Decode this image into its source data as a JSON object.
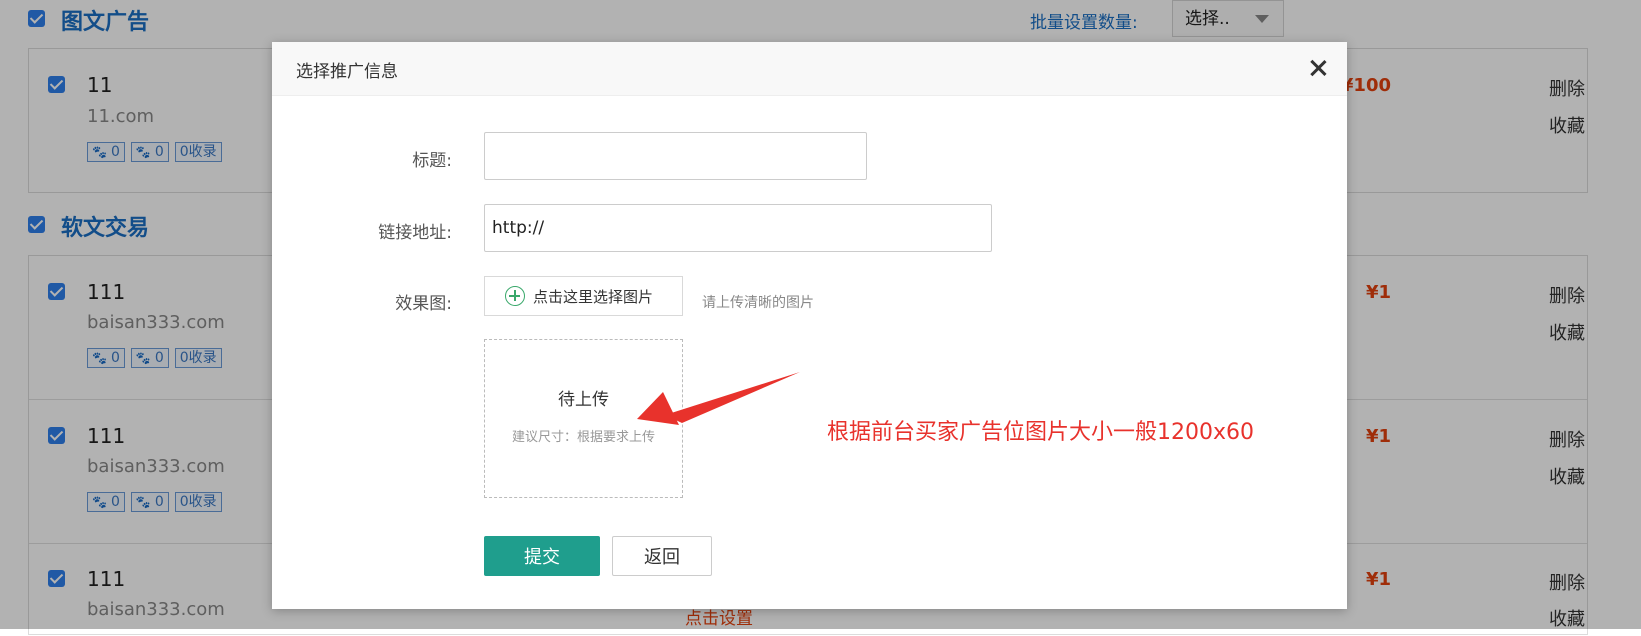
{
  "background": {
    "batch_label": "批量设置数量:",
    "batch_select_value": "选择..",
    "sections": [
      {
        "title": "图文广告",
        "rows": [
          {
            "name": "11",
            "domain": "11.com",
            "badge1": "0",
            "badge2": "0",
            "badge3": "0收录",
            "price": "¥100",
            "delete": "删除",
            "favorite": "收藏"
          }
        ]
      },
      {
        "title": "软文交易",
        "rows": [
          {
            "name": "111",
            "domain": "baisan333.com",
            "badge1": "0",
            "badge2": "0",
            "badge3": "0收录",
            "price": "¥1",
            "delete": "删除",
            "favorite": "收藏"
          },
          {
            "name": "111",
            "domain": "baisan333.com",
            "badge1": "0",
            "badge2": "0",
            "badge3": "0收录",
            "price": "¥1",
            "delete": "删除",
            "favorite": "收藏"
          },
          {
            "name": "111",
            "domain": "baisan333.com",
            "price": "¥1",
            "delete": "删除",
            "favorite": "收藏"
          }
        ]
      }
    ],
    "set_link": "点击设置"
  },
  "modal": {
    "title": "选择推广信息",
    "title_label": "标题:",
    "title_value": "",
    "url_label": "链接地址:",
    "url_value": "http://",
    "image_label": "效果图:",
    "upload_button": "点击这里选择图片",
    "upload_hint": "请上传清晰的图片",
    "dropzone_title": "待上传",
    "dropzone_sub": "建议尺寸：根据要求上传",
    "submit": "提交",
    "back": "返回"
  },
  "annotation": {
    "note": "根据前台买家广告位图片大小一般1200x60",
    "color": "#e8322c"
  }
}
